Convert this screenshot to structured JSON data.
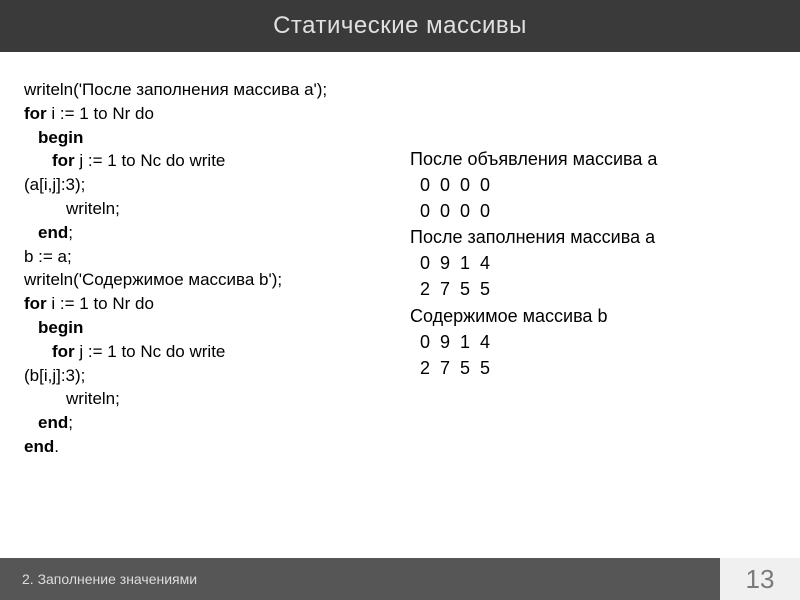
{
  "header": {
    "title": "Статические массивы"
  },
  "code": {
    "l1": "writeln('После заполнения массива a');",
    "l2a": "for",
    "l2b": " i := 1 to Nr do",
    "l3": "begin",
    "l4a": "for",
    "l4b": " j := 1 to Nc do write",
    "l5": "(a[i,j]:3);",
    "l6": "writeln;",
    "l7a": "end",
    "l7b": ";",
    "l8": "b := a;",
    "l9": "writeln('Содержимое массива b');",
    "l10a": "for",
    "l10b": " i := 1 to Nr do",
    "l11": "begin",
    "l12a": "for",
    "l12b": " j := 1 to Nc do write",
    "l13": "(b[i,j]:3);",
    "l14": "writeln;",
    "l15a": "end",
    "l15b": ";",
    "l16a": "end",
    "l16b": "."
  },
  "output": {
    "t1": "После объявления массива a",
    "r1": "  0  0  0  0",
    "r2": "  0  0  0  0",
    "t2": "После заполнения массива a",
    "r3": "  0  9  1  4",
    "r4": "  2  7  5  5",
    "t3": "Содержимое массива b",
    "r5": "  0  9  1  4",
    "r6": "  2  7  5  5"
  },
  "footer": {
    "section": "2. Заполнение значениями",
    "page": "13"
  }
}
